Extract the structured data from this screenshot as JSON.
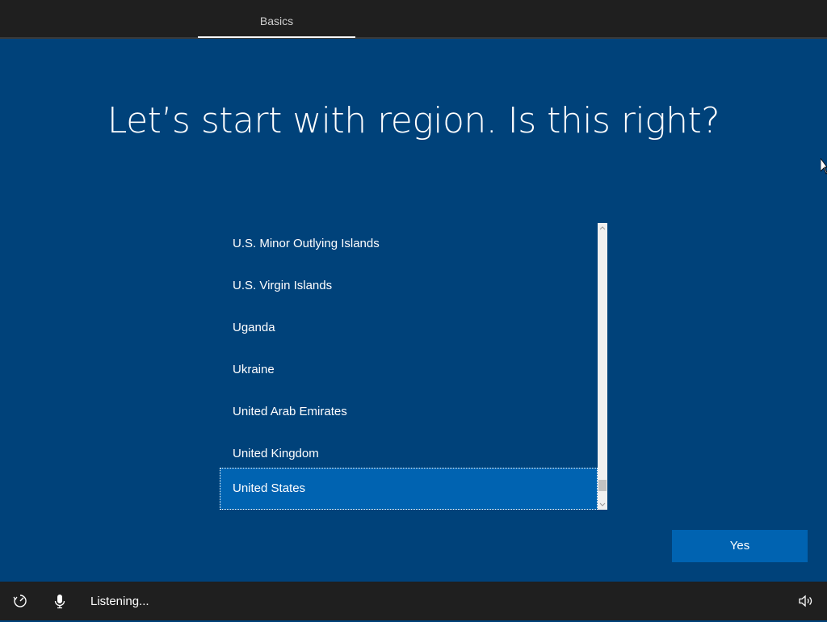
{
  "header": {
    "tab_label": "Basics"
  },
  "main": {
    "title": "Let’s start with region. Is this right?"
  },
  "region_list": {
    "items": [
      {
        "label": "U.S. Minor Outlying Islands",
        "selected": false
      },
      {
        "label": "U.S. Virgin Islands",
        "selected": false
      },
      {
        "label": "Uganda",
        "selected": false
      },
      {
        "label": "Ukraine",
        "selected": false
      },
      {
        "label": "United Arab Emirates",
        "selected": false
      },
      {
        "label": "United Kingdom",
        "selected": false
      },
      {
        "label": "United States",
        "selected": true
      }
    ],
    "scroll_up_icon": "chevron-up-icon",
    "scroll_down_icon": "chevron-down-icon"
  },
  "actions": {
    "yes_label": "Yes"
  },
  "footer": {
    "ease_of_access_icon": "ease-of-access-icon",
    "microphone_icon": "microphone-icon",
    "status_text": "Listening...",
    "volume_icon": "volume-icon"
  },
  "colors": {
    "background": "#00427a",
    "accent": "#0063b1",
    "bar": "#1f1f1f"
  }
}
